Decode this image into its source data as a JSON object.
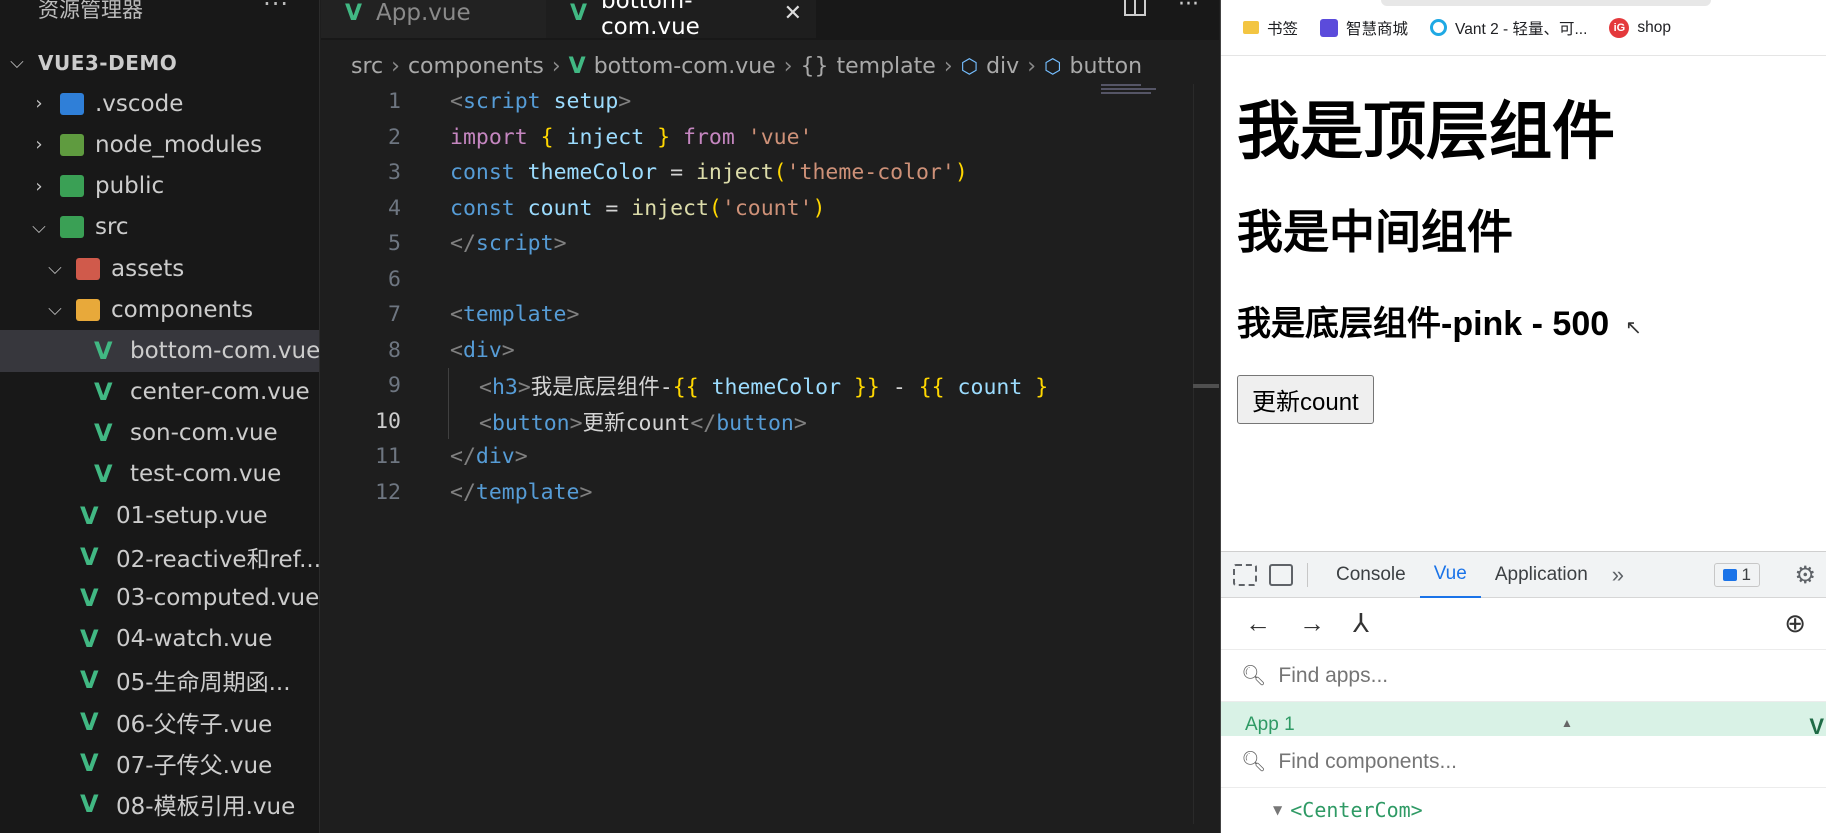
{
  "explorer": {
    "title": "资源管理器",
    "more": "···",
    "root": "VUE3-DEMO",
    "items": [
      {
        "label": ".vscode",
        "type": "folder",
        "icon": "vscode-folder-icon"
      },
      {
        "label": "node_modules",
        "type": "folder",
        "icon": "node-folder-icon"
      },
      {
        "label": "public",
        "type": "folder",
        "icon": "public-folder-icon"
      },
      {
        "label": "src",
        "type": "folder",
        "icon": "src-folder-icon"
      },
      {
        "label": "assets",
        "type": "folder",
        "icon": "assets-folder-icon"
      },
      {
        "label": "components",
        "type": "folder",
        "icon": "components-folder-icon"
      },
      {
        "label": "bottom-com.vue",
        "type": "vue"
      },
      {
        "label": "center-com.vue",
        "type": "vue"
      },
      {
        "label": "son-com.vue",
        "type": "vue"
      },
      {
        "label": "test-com.vue",
        "type": "vue"
      },
      {
        "label": "01-setup.vue",
        "type": "vue"
      },
      {
        "label": "02-reactive和ref....",
        "type": "vue"
      },
      {
        "label": "03-computed.vue",
        "type": "vue"
      },
      {
        "label": "04-watch.vue",
        "type": "vue"
      },
      {
        "label": "05-生命周期函...",
        "type": "vue"
      },
      {
        "label": "06-父传子.vue",
        "type": "vue"
      },
      {
        "label": "07-子传父.vue",
        "type": "vue"
      },
      {
        "label": "08-模板引用.vue",
        "type": "vue"
      }
    ]
  },
  "tabs": {
    "inactive": "App.vue",
    "active": "bottom-com.vue",
    "close": "✕"
  },
  "breadcrumb": {
    "src": "src",
    "components": "components",
    "file": "bottom-com.vue",
    "template": "template",
    "div": "div",
    "button": "button"
  },
  "code": {
    "line_numbers": [
      "1",
      "2",
      "3",
      "4",
      "5",
      "6",
      "7",
      "8",
      "9",
      "10",
      "11",
      "12"
    ],
    "l1": {
      "open": "<",
      "tag": "script",
      "attr": " setup",
      "close": ">"
    },
    "l2": {
      "kw": "import",
      "b1": " { ",
      "var": "inject",
      "b2": " } ",
      "kw2": "from",
      "str": " 'vue'"
    },
    "l3": {
      "kw": "const",
      "var": " themeColor",
      "eq": " = ",
      "fn": "inject",
      "p1": "(",
      "str": "'theme-color'",
      "p2": ")"
    },
    "l4": {
      "kw": "const",
      "var": " count",
      "eq": " = ",
      "fn": "inject",
      "p1": "(",
      "str": "'count'",
      "p2": ")"
    },
    "l5": {
      "open": "</",
      "tag": "script",
      "close": ">"
    },
    "l7": {
      "open": "<",
      "tag": "template",
      "close": ">"
    },
    "l8": {
      "open": "<",
      "tag": "div",
      "close": ">"
    },
    "l9": {
      "open": "<",
      "tag": "h3",
      "close": ">",
      "text": "我是底层组件-",
      "m1": "{{",
      "var1": " themeColor ",
      "m2": "}}",
      "dash": " - ",
      "m3": "{{",
      "var2": " count ",
      "m4": "}"
    },
    "l10": {
      "open": "<",
      "tag": "button",
      "close": ">",
      "text": "更新count",
      "eopen": "</",
      "etag": "button",
      "eclose": ">"
    },
    "l11": {
      "open": "</",
      "tag": "div",
      "close": ">"
    },
    "l12": {
      "open": "</",
      "tag": "template",
      "close": ">"
    }
  },
  "bookmarks": [
    {
      "label": "书签",
      "icon": "folder-icon"
    },
    {
      "label": "智慧商城",
      "icon": "smart-mall-icon"
    },
    {
      "label": "Vant 2 - 轻量、可...",
      "icon": "vant-icon"
    },
    {
      "label": "shop",
      "icon": "shop-icon"
    }
  ],
  "page": {
    "h1": "我是顶层组件",
    "h2": "我是中间组件",
    "h3": "我是底层组件-pink - 500",
    "button": "更新count"
  },
  "devtools": {
    "tabs": [
      "Console",
      "Vue",
      "Application"
    ],
    "active_tab": "Vue",
    "more": "»",
    "badge": "1",
    "find_apps": "Find apps...",
    "app_row": "App 1",
    "find_components": "Find components...",
    "component": "<CenterCom>"
  },
  "colors": {
    "vue_green": "#41b883",
    "selected_row": "#37373d",
    "devtools_accent": "#1a73e8"
  }
}
